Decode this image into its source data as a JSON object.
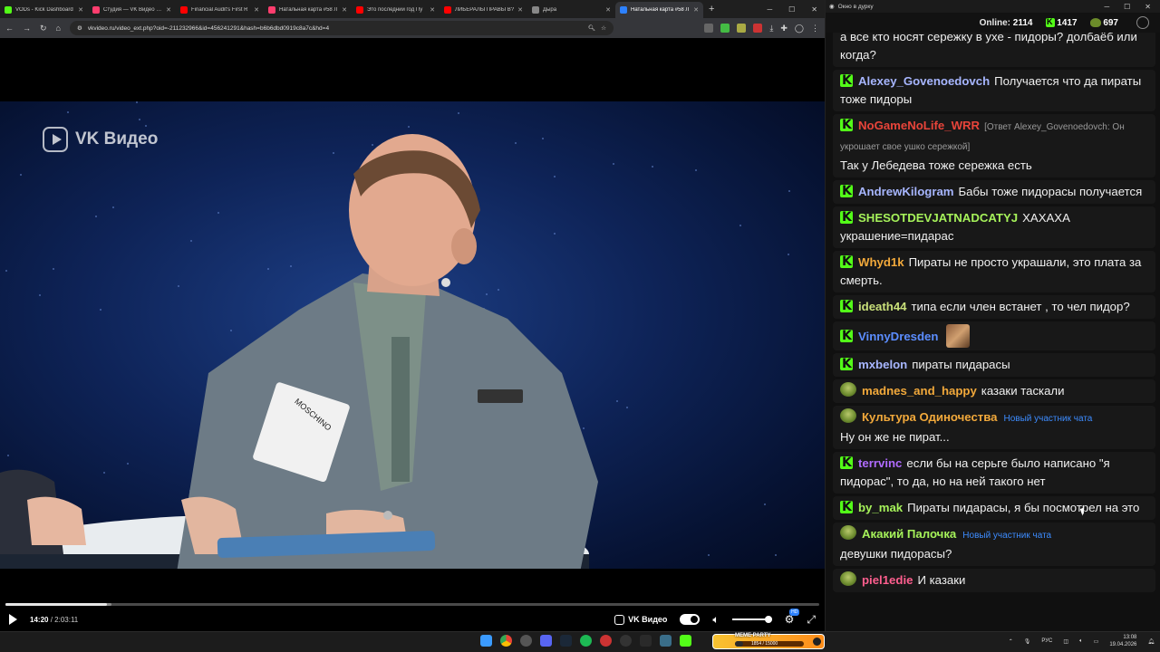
{
  "browser": {
    "tabs": [
      {
        "title": "VODs - Kick Dashboard",
        "color": "#53fc18"
      },
      {
        "title": "Студия — VK Видео Live",
        "color": "#ff3d6e"
      },
      {
        "title": "Financial Audit's First R",
        "color": "#ff0000"
      },
      {
        "title": "Натальная карта #58 Л",
        "color": "#ff3d6e"
      },
      {
        "title": "Это последний год Пу",
        "color": "#ff0000"
      },
      {
        "title": "ЛИБЕРАЛЫ ПРАВЫ В?",
        "color": "#ff0000"
      },
      {
        "title": "Дыра",
        "color": "#888888"
      },
      {
        "title": "Натальная карта #58 Л",
        "color": "#2d81ff",
        "active": true
      }
    ],
    "url": "vkvideo.ru/video_ext.php?oid=-211232966&id=456241291&hash=b6b6dbd0919c8a7c&hd=4"
  },
  "video": {
    "logo_text": "VK Видео",
    "current_time": "14:20",
    "duration": "2:03:11",
    "progress_fraction": 0.125,
    "buffered_fraction": 0.13,
    "brand_label": "VK Видео"
  },
  "chat": {
    "window_title": "Окно в дурку",
    "online_label": "Online:",
    "online_count": "2114",
    "followers": "1417",
    "subs": "697",
    "messages": [
      {
        "badge": "none",
        "name": "",
        "color": "#ffffff",
        "text": "а все кто носят сережку в ухе - пидоры? долбаёб или когда?"
      },
      {
        "badge": "kick",
        "name": "Alexey_Govenoedovch",
        "color": "#a7b6ff",
        "text": "Получается что да пираты тоже пидоры"
      },
      {
        "badge": "kick",
        "name": "NoGameNoLife_WRR",
        "color": "#e8443a",
        "reply": "[Ответ Alexey_Govenoedovch: Он укрошает свое ушко сережкой]",
        "text": "Так у Лебедева тоже сережка есть"
      },
      {
        "badge": "kick",
        "name": "AndrewKilogram",
        "color": "#a7b6ff",
        "text": "Бабы тоже пидорасы получается"
      },
      {
        "badge": "kick",
        "name": "SHESOTDEVJATNADCATYJ",
        "color": "#a6f25a",
        "text": "ХАХАХА украшение=пидарас"
      },
      {
        "badge": "kick",
        "name": "Whyd1k",
        "color": "#f2a93b",
        "text": "Пираты не просто украшали, это плата за смерть."
      },
      {
        "badge": "kick",
        "name": "ideath44",
        "color": "#c9e07a",
        "text": "типа если член встанет , то чел пидор?"
      },
      {
        "badge": "kick",
        "name": "VinnyDresden",
        "color": "#5b8dff",
        "text": "",
        "emote": true
      },
      {
        "badge": "kick",
        "name": "mxbelon",
        "color": "#a7b6ff",
        "text": "пираты пидарасы"
      },
      {
        "badge": "frog",
        "name": "madnes_and_happy",
        "color": "#f2a93b",
        "text": "казаки таскали"
      },
      {
        "badge": "frog",
        "name": "Культура Одиночества",
        "color": "#f2a93b",
        "newuser": "Новый участник чата",
        "text": "Ну он же не пират..."
      },
      {
        "badge": "kick",
        "name": "terrvinc",
        "color": "#b06bff",
        "text": "если бы на серьге было написано \"я пидорас\", то да, но на ней такого нет"
      },
      {
        "badge": "kick",
        "name": "by_mak",
        "color": "#a6f25a",
        "text": "Пираты пидарасы, я бы посмотрел на это"
      },
      {
        "badge": "frog",
        "name": "Акакий Палочка",
        "color": "#a6f25a",
        "newuser": "Новый участник чата",
        "text": "девушки пидорасы?"
      },
      {
        "badge": "frog",
        "name": "piel1edie",
        "color": "#ff5f8f",
        "text": "И казаки"
      }
    ]
  },
  "taskbar": {
    "meme_title": "MEME PARTY",
    "meme_progress": "1854 / 15000",
    "meme_fraction": 0.12,
    "lang": "РУС",
    "time": "13:08",
    "date": "19.04.2026"
  }
}
